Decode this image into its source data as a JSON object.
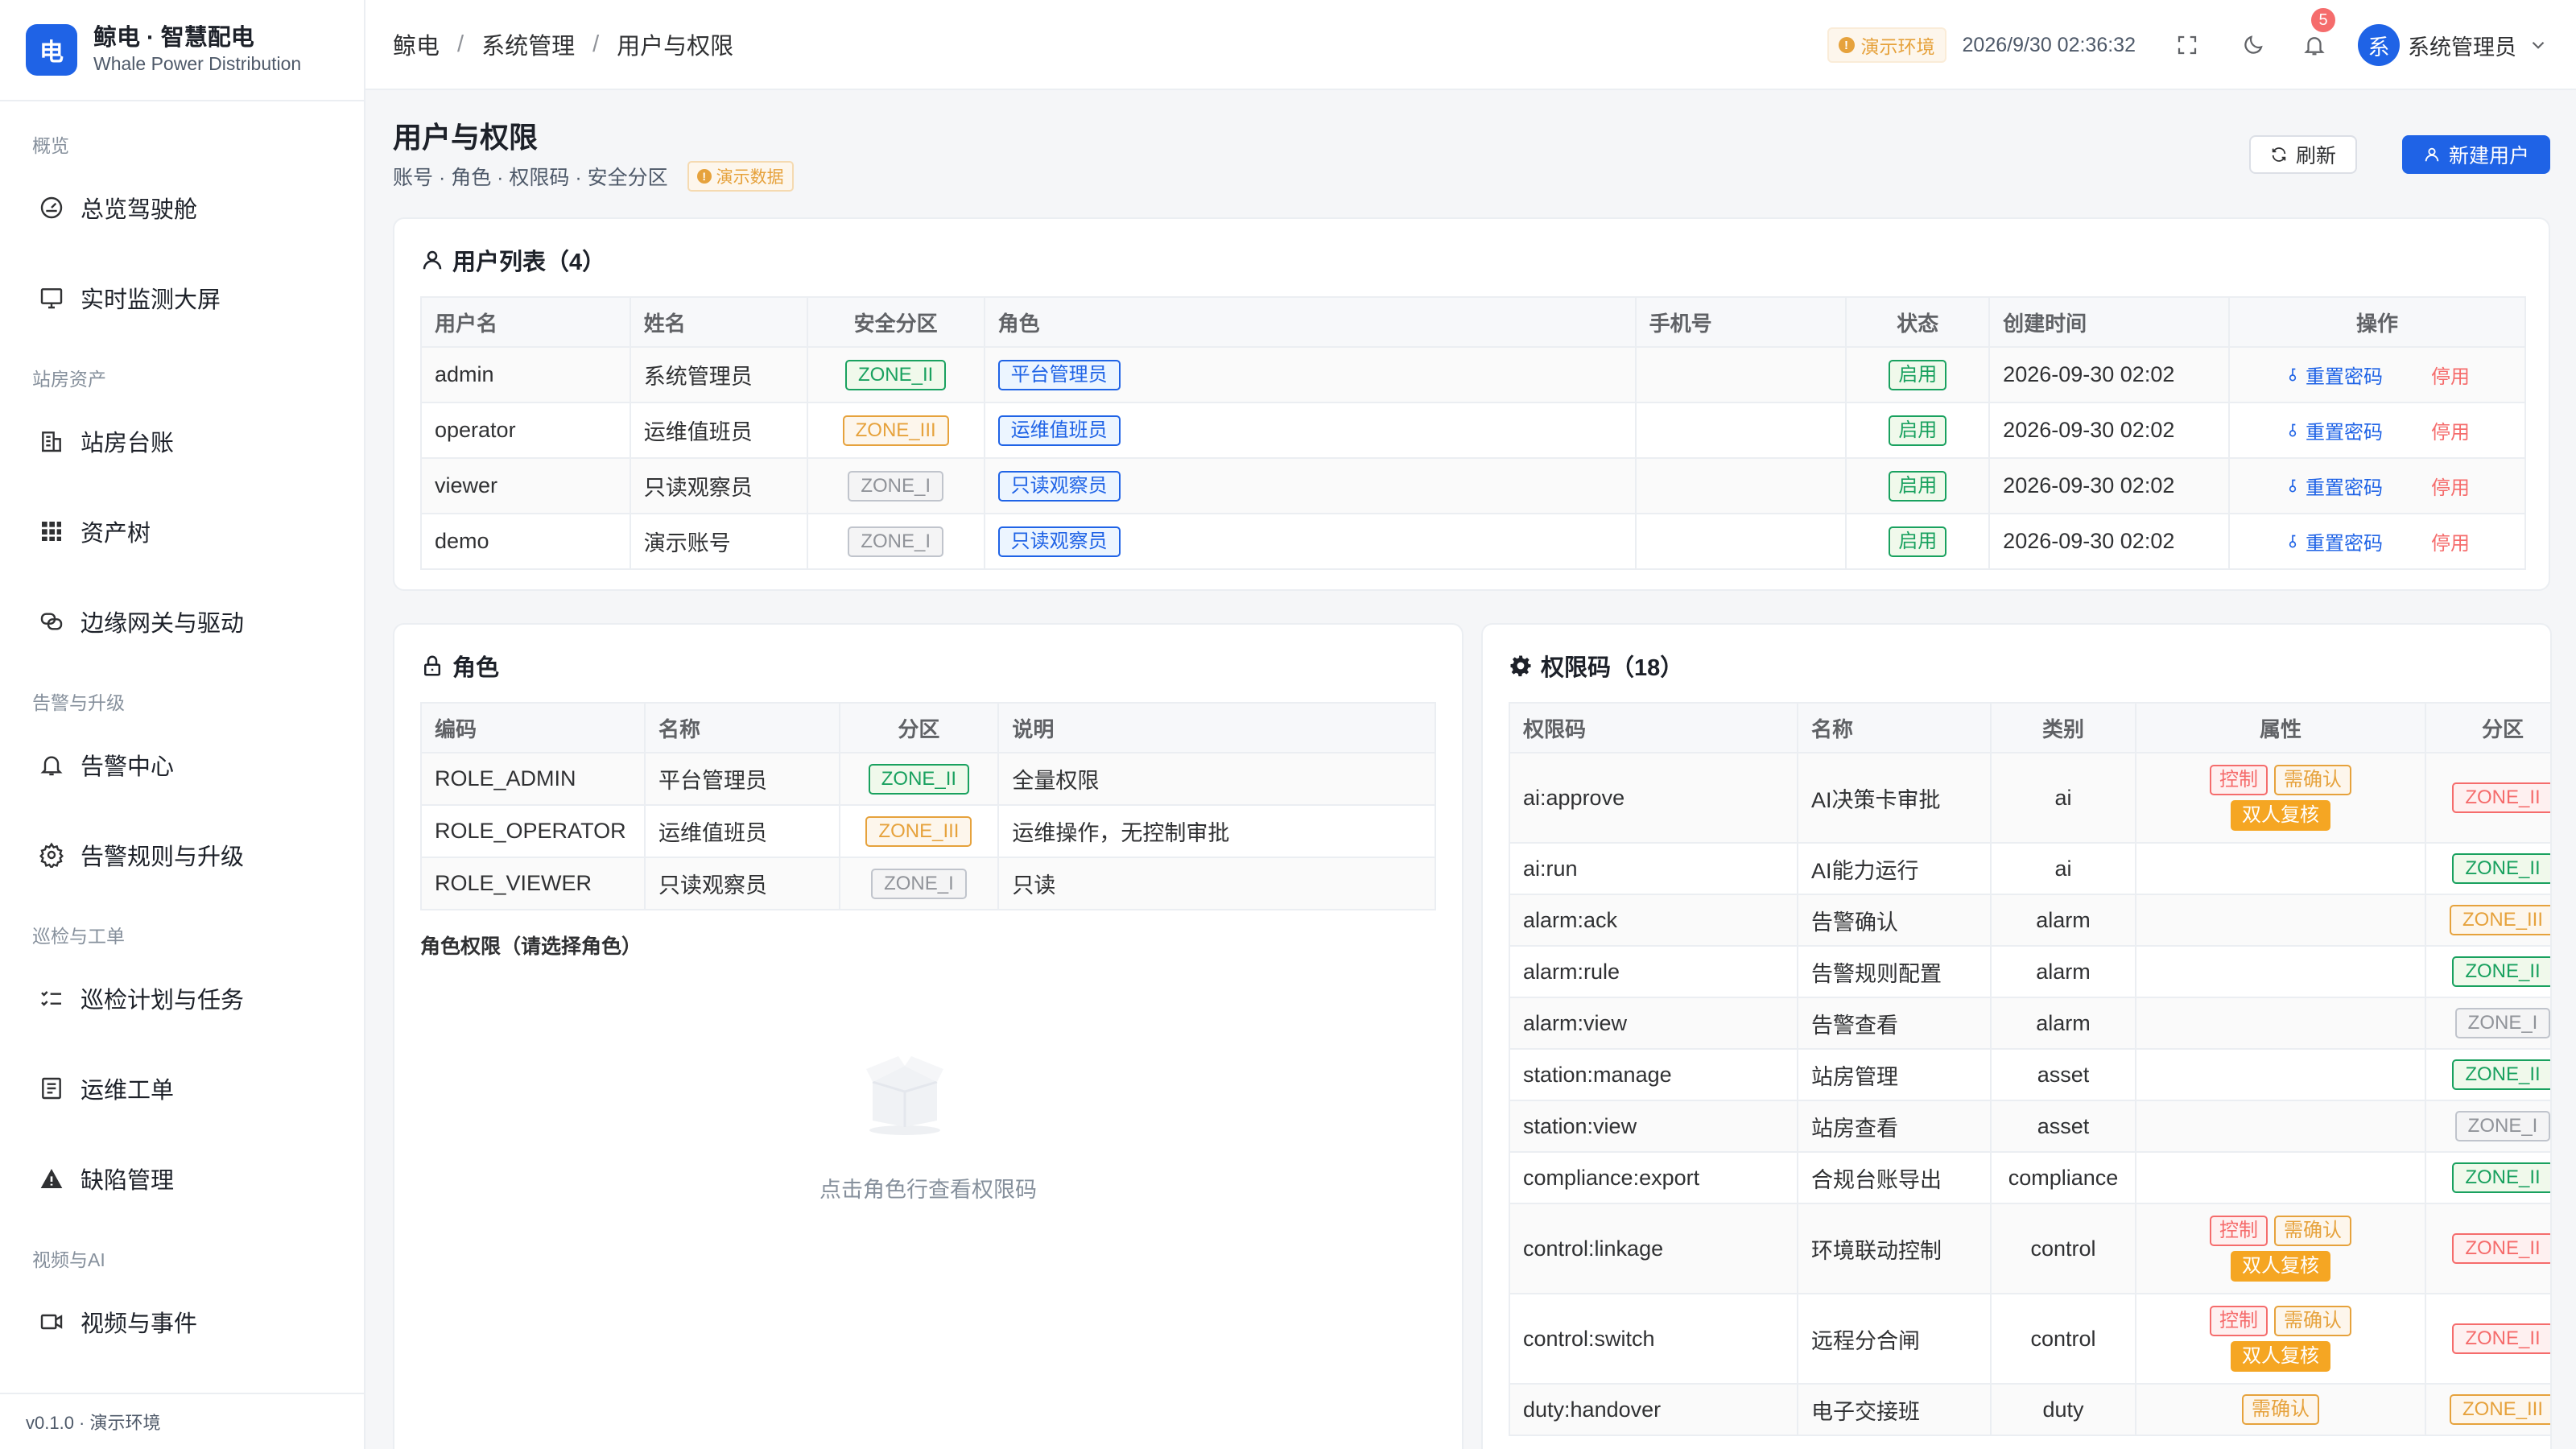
{
  "brand": {
    "logo": "电",
    "title": "鲸电 · 智慧配电",
    "subtitle": "Whale Power Distribution"
  },
  "sidebar": {
    "g1": "概览",
    "g2": "站房资产",
    "g3": "告警与升级",
    "g4": "巡检与工单",
    "g5": "视频与AI",
    "items": [
      "总览驾驶舱",
      "实时监测大屏",
      "站房台账",
      "资产树",
      "边缘网关与驱动",
      "告警中心",
      "告警规则与升级",
      "巡检计划与任务",
      "运维工单",
      "缺陷管理",
      "视频与事件"
    ],
    "version": "v0.1.0 · 演示环境"
  },
  "topbar": {
    "crumbs": [
      "鲸电",
      "系统管理",
      "用户与权限"
    ],
    "sep": "/",
    "env": "演示环境",
    "env_icon": "!",
    "time": "2026/9/30 02:36:32",
    "notif_count": "5",
    "avatar": "系",
    "user": "系统管理员"
  },
  "page": {
    "title": "用户与权限",
    "subtitle": "账号 · 角色 · 权限码 · 安全分区",
    "demo_tag": "演示数据",
    "demo_icon": "!",
    "refresh": "刷新",
    "new_user": "新建用户"
  },
  "users": {
    "title": "用户列表（4）",
    "headers": [
      "用户名",
      "姓名",
      "安全分区",
      "角色",
      "手机号",
      "状态",
      "创建时间",
      "操作"
    ],
    "rows": [
      {
        "username": "admin",
        "name": "系统管理员",
        "zone": "ZONE_II",
        "role": "平台管理员",
        "phone": "",
        "status": "启用",
        "created": "2026-09-30 02:02",
        "reset": "重置密码",
        "disable": "停用"
      },
      {
        "username": "operator",
        "name": "运维值班员",
        "zone": "ZONE_III",
        "role": "运维值班员",
        "phone": "",
        "status": "启用",
        "created": "2026-09-30 02:02",
        "reset": "重置密码",
        "disable": "停用"
      },
      {
        "username": "viewer",
        "name": "只读观察员",
        "zone": "ZONE_I",
        "role": "只读观察员",
        "phone": "",
        "status": "启用",
        "created": "2026-09-30 02:02",
        "reset": "重置密码",
        "disable": "停用"
      },
      {
        "username": "demo",
        "name": "演示账号",
        "zone": "ZONE_I",
        "role": "只读观察员",
        "phone": "",
        "status": "启用",
        "created": "2026-09-30 02:02",
        "reset": "重置密码",
        "disable": "停用"
      }
    ]
  },
  "roles": {
    "title": "角色",
    "headers": [
      "编码",
      "名称",
      "分区",
      "说明"
    ],
    "rows": [
      {
        "code": "ROLE_ADMIN",
        "name": "平台管理员",
        "zone": "ZONE_II",
        "desc": "全量权限"
      },
      {
        "code": "ROLE_OPERATOR",
        "name": "运维值班员",
        "zone": "ZONE_III",
        "desc": "运维操作，无控制审批"
      },
      {
        "code": "ROLE_VIEWER",
        "name": "只读观察员",
        "zone": "ZONE_I",
        "desc": "只读"
      }
    ],
    "perm_title": "角色权限（请选择角色）",
    "empty": "点击角色行查看权限码"
  },
  "perms": {
    "title": "权限码（18）",
    "headers": [
      "权限码",
      "名称",
      "类别",
      "属性",
      "分区"
    ],
    "rows": [
      {
        "code": "ai:approve",
        "name": "AI决策卡审批",
        "cat": "ai",
        "ctl": "控制",
        "conf": "需确认",
        "dual": "双人复核",
        "zone": "ZONE_II"
      },
      {
        "code": "ai:run",
        "name": "AI能力运行",
        "cat": "ai",
        "zone": "ZONE_II"
      },
      {
        "code": "alarm:ack",
        "name": "告警确认",
        "cat": "alarm",
        "zone": "ZONE_III"
      },
      {
        "code": "alarm:rule",
        "name": "告警规则配置",
        "cat": "alarm",
        "zone": "ZONE_II"
      },
      {
        "code": "alarm:view",
        "name": "告警查看",
        "cat": "alarm",
        "zone": "ZONE_I"
      },
      {
        "code": "station:manage",
        "name": "站房管理",
        "cat": "asset",
        "zone": "ZONE_II"
      },
      {
        "code": "station:view",
        "name": "站房查看",
        "cat": "asset",
        "zone": "ZONE_I"
      },
      {
        "code": "compliance:export",
        "name": "合规台账导出",
        "cat": "compliance",
        "zone": "ZONE_II"
      },
      {
        "code": "control:linkage",
        "name": "环境联动控制",
        "cat": "control",
        "ctl": "控制",
        "conf": "需确认",
        "dual": "双人复核",
        "zone": "ZONE_II"
      },
      {
        "code": "control:switch",
        "name": "远程分合闸",
        "cat": "control",
        "ctl": "控制",
        "conf": "需确认",
        "dual": "双人复核",
        "zone": "ZONE_II"
      },
      {
        "code": "duty:handover",
        "name": "电子交接班",
        "cat": "duty",
        "conf": "需确认",
        "zone": "ZONE_III"
      }
    ]
  },
  "colors": {
    "primary": "#1f63e6",
    "success": "#19a15f",
    "warning": "#e6a23c",
    "danger": "#f56c6c"
  }
}
